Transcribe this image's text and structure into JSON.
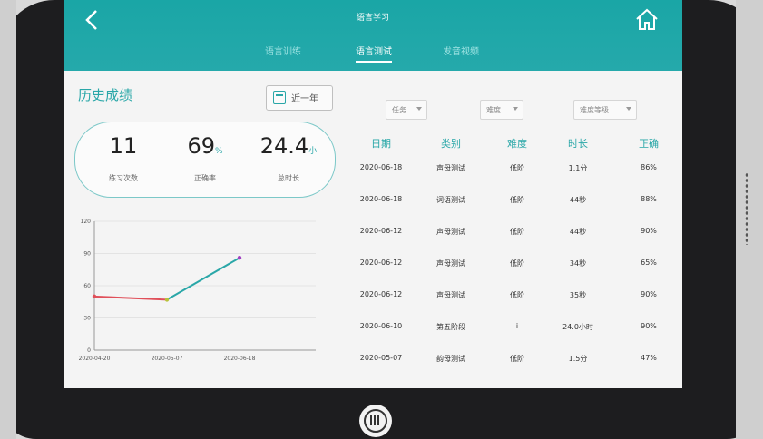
{
  "header": {
    "title": "语言学习",
    "tabs": [
      {
        "label": "语言训练",
        "active": false
      },
      {
        "label": "语言测试",
        "active": true
      },
      {
        "label": "发音视频",
        "active": false
      }
    ]
  },
  "history": {
    "title": "历史成绩",
    "range_button": "近一年",
    "stats": [
      {
        "value": "11",
        "unit": "",
        "label": "练习次数"
      },
      {
        "value": "69",
        "unit": "%",
        "label": "正确率"
      },
      {
        "value": "24.4",
        "unit": "小",
        "label": "总时长"
      }
    ]
  },
  "filters": [
    {
      "label": "任务"
    },
    {
      "label": "难度"
    },
    {
      "label": "难度等级"
    }
  ],
  "table": {
    "columns": [
      "日期",
      "类别",
      "难度",
      "时长",
      "正确"
    ],
    "rows": [
      {
        "date": "2020-06-18",
        "category": "声母测试",
        "level": "低阶",
        "duration": "1.1分",
        "correct": "86%"
      },
      {
        "date": "2020-06-18",
        "category": "词语测试",
        "level": "低阶",
        "duration": "44秒",
        "correct": "88%"
      },
      {
        "date": "2020-06-12",
        "category": "声母测试",
        "level": "低阶",
        "duration": "44秒",
        "correct": "90%"
      },
      {
        "date": "2020-06-12",
        "category": "声母测试",
        "level": "低阶",
        "duration": "34秒",
        "correct": "65%"
      },
      {
        "date": "2020-06-12",
        "category": "声母测试",
        "level": "低阶",
        "duration": "35秒",
        "correct": "90%"
      },
      {
        "date": "2020-06-10",
        "category": "第五阶段",
        "level": "i",
        "duration": "24.0小时",
        "correct": "90%"
      },
      {
        "date": "2020-05-07",
        "category": "韵母测试",
        "level": "低阶",
        "duration": "1.5分",
        "correct": "47%"
      }
    ]
  },
  "chart_data": {
    "type": "line",
    "x": [
      "2020-04-20",
      "2020-05-07",
      "2020-06-18"
    ],
    "y": [
      50,
      47,
      86
    ],
    "ylim": [
      0,
      120
    ],
    "yticks": [
      0,
      30,
      60,
      90,
      120
    ],
    "grid": true,
    "colors": {
      "line_start": "#e0505a",
      "line_end": "#2aa7a8"
    }
  },
  "colors": {
    "accent": "#2aa7a8",
    "header": "#1aa6a6"
  }
}
